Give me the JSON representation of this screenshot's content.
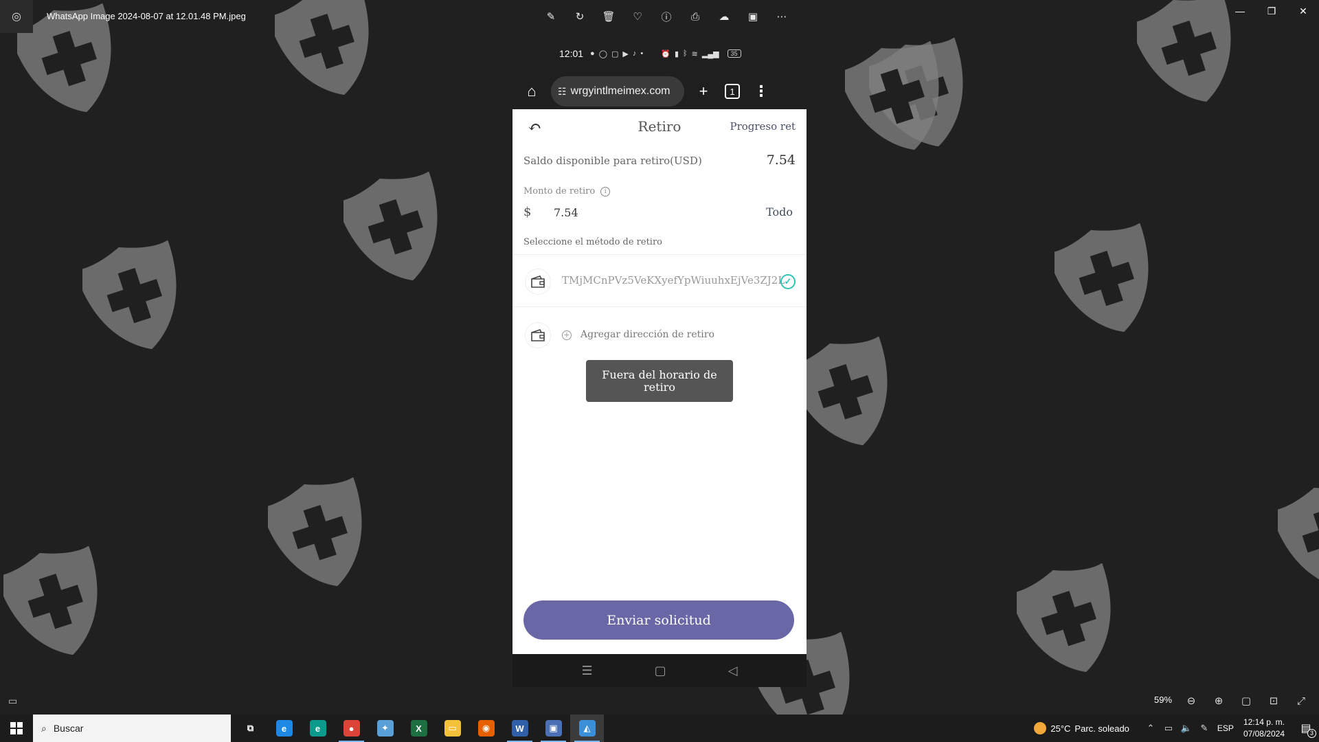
{
  "window": {
    "file_title": "WhatsApp Image 2024-08-07 at 12.01.48 PM.jpeg",
    "tools": [
      {
        "name": "edit-image-icon",
        "glyph": "✎"
      },
      {
        "name": "rotate-icon",
        "glyph": "↻"
      },
      {
        "name": "delete-icon",
        "glyph": "🗑"
      },
      {
        "name": "favorite-icon",
        "glyph": "♡"
      },
      {
        "name": "info-icon",
        "glyph": "ⓘ"
      },
      {
        "name": "print-icon",
        "glyph": "⎙"
      },
      {
        "name": "onedrive-icon",
        "glyph": "☁"
      },
      {
        "name": "clipchamp-icon",
        "glyph": "▣"
      },
      {
        "name": "more-icon",
        "glyph": "⋯"
      }
    ],
    "controls": {
      "minimize": "—",
      "maximize": "❐",
      "close": "✕"
    }
  },
  "phone": {
    "status": {
      "time": "12:01",
      "battery": "35"
    },
    "browser": {
      "url": "wrgyintlmeimex.com",
      "tab_count": "1"
    },
    "page": {
      "title": "Retiro",
      "progress_link": "Progreso ret",
      "balance_label": "Saldo disponible para retiro(USD)",
      "balance_value": "7.54",
      "amount_label": "Monto de retiro",
      "currency_symbol": "$",
      "amount_value": "7.54",
      "all_button": "Todo",
      "method_label": "Seleccione el método de retiro",
      "wallet_address": "TMjMCnPVz5VeKXyefYpWiuuhxEjVe3ZJ2L",
      "add_address": "Agregar dirección de retiro",
      "toast": "Fuera del horario de retiro",
      "submit": "Enviar solicitud"
    }
  },
  "viewer": {
    "zoom": "59%"
  },
  "taskbar": {
    "search_placeholder": "Buscar",
    "apps": [
      {
        "name": "task-view-icon",
        "glyph": "⧉",
        "color": "#1c1c1c"
      },
      {
        "name": "internet-explorer-icon",
        "glyph": "e",
        "color": "#1e88e5"
      },
      {
        "name": "edge-icon",
        "glyph": "e",
        "color": "#0a9b8c"
      },
      {
        "name": "chrome-icon",
        "glyph": "●",
        "color": "#db4437"
      },
      {
        "name": "paint-icon",
        "glyph": "✦",
        "color": "#5aa0d8"
      },
      {
        "name": "excel-icon",
        "glyph": "X",
        "color": "#1d6f42"
      },
      {
        "name": "file-explorer-icon",
        "glyph": "▭",
        "color": "#f4c13b"
      },
      {
        "name": "firefox-icon",
        "glyph": "◉",
        "color": "#e66000"
      },
      {
        "name": "whatsapp-app-icon",
        "glyph": "W",
        "color": "#2f5fa8"
      },
      {
        "name": "remote-desktop-icon",
        "glyph": "▣",
        "color": "#4a6fb5"
      },
      {
        "name": "photos-icon",
        "glyph": "◭",
        "color": "#3a8fd8"
      }
    ],
    "weather": {
      "temp": "25°C",
      "desc": "Parc. soleado"
    },
    "language": "ESP",
    "time": "12:14 p. m.",
    "date": "07/08/2024",
    "notifications": "3"
  }
}
